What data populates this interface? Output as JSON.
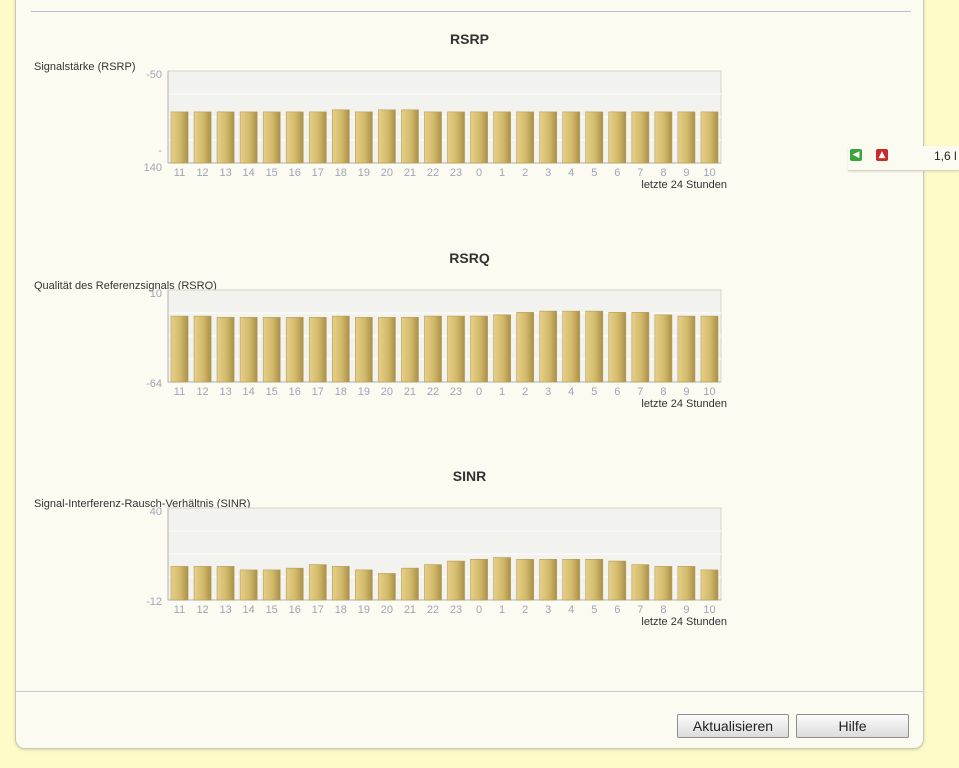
{
  "side_widget": {
    "prev_icon": "arrow-left-icon",
    "up_icon": "arrow-up-icon",
    "value": "1,6 l"
  },
  "buttons": {
    "refresh_label": "Aktualisieren",
    "help_label": "Hilfe"
  },
  "colors": {
    "bar_fill": "#d2b96a",
    "bar_dark": "#a8904a",
    "plot_bg": "#f2f2ee",
    "grid": "#ffffff",
    "tick": "#a3a3b5"
  },
  "chart_data": [
    {
      "type": "bar",
      "title": "RSRP",
      "subtitle": "Signalstärke (RSRP)",
      "xlabel": "letzte 24 Stunden",
      "ylabel": "",
      "y_tick_labels": [
        "-50",
        "-",
        "140"
      ],
      "ylim": [
        -140,
        -50
      ],
      "categories": [
        "11",
        "12",
        "13",
        "14",
        "15",
        "16",
        "17",
        "18",
        "19",
        "20",
        "21",
        "22",
        "23",
        "0",
        "1",
        "2",
        "3",
        "4",
        "5",
        "6",
        "7",
        "8",
        "9",
        "10"
      ],
      "values": [
        -90,
        -90,
        -90,
        -90,
        -90,
        -90,
        -90,
        -88,
        -90,
        -88,
        -88,
        -90,
        -90,
        -90,
        -90,
        -90,
        -90,
        -90,
        -90,
        -90,
        -90,
        -90,
        -90,
        -90
      ]
    },
    {
      "type": "bar",
      "title": "RSRQ",
      "subtitle": "Qualität des Referenzsignals (RSRQ)",
      "xlabel": "letzte 24 Stunden",
      "ylabel": "",
      "y_tick_labels": [
        "10",
        "-64"
      ],
      "ylim": [
        -64,
        10
      ],
      "categories": [
        "11",
        "12",
        "13",
        "14",
        "15",
        "16",
        "17",
        "18",
        "19",
        "20",
        "21",
        "22",
        "23",
        "0",
        "1",
        "2",
        "3",
        "4",
        "5",
        "6",
        "7",
        "8",
        "9",
        "10"
      ],
      "values": [
        -11,
        -11,
        -12,
        -12,
        -12,
        -12,
        -12,
        -11,
        -12,
        -12,
        -12,
        -11,
        -11,
        -11,
        -10,
        -8,
        -7,
        -7,
        -7,
        -8,
        -8,
        -10,
        -11,
        -11
      ]
    },
    {
      "type": "bar",
      "title": "SINR",
      "subtitle": "Signal-Interferenz-Rausch-Verhältnis (SINR)",
      "xlabel": "letzte 24 Stunden",
      "ylabel": "",
      "y_tick_labels": [
        "40",
        "-12"
      ],
      "ylim": [
        -12,
        40
      ],
      "categories": [
        "11",
        "12",
        "13",
        "14",
        "15",
        "16",
        "17",
        "18",
        "19",
        "20",
        "21",
        "22",
        "23",
        "0",
        "1",
        "2",
        "3",
        "4",
        "5",
        "6",
        "7",
        "8",
        "9",
        "10"
      ],
      "values": [
        7,
        7,
        7,
        5,
        5,
        6,
        8,
        7,
        5,
        3,
        6,
        8,
        10,
        11,
        12,
        11,
        11,
        11,
        11,
        10,
        8,
        7,
        7,
        5
      ]
    }
  ]
}
